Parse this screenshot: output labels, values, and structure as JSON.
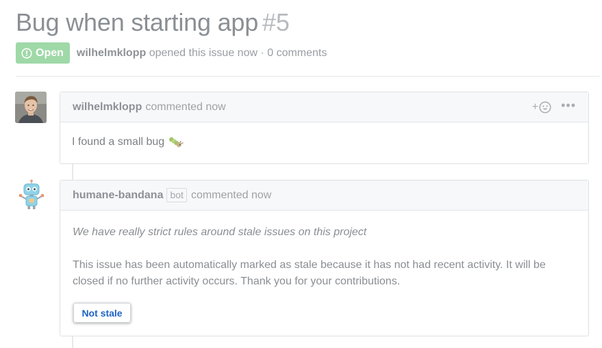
{
  "issue": {
    "title": "Bug when starting app",
    "number": "#5",
    "state": "Open",
    "author": "wilhelmklopp",
    "meta_suffix": "opened this issue now · 0 comments"
  },
  "comments": [
    {
      "author": "wilhelmklopp",
      "action": "commented now",
      "body": "I found a small bug"
    },
    {
      "author": "humane-bandana",
      "badge": "bot",
      "action": "commented now",
      "rules": "We have really strict rules around stale issues on this project",
      "message": "This issue has been automatically marked as stale because it has not had recent activity. It will be closed if no further activity occurs. Thank you for your contributions.",
      "button_label": "Not stale"
    }
  ],
  "icons": {
    "state": "issue-opened-icon",
    "reaction": "smiley-icon",
    "more": "kebab-horizontal-icon",
    "bug": "caterpillar-icon"
  },
  "colors": {
    "open_badge": "#9fd9a8",
    "link_button": "#1f61c4"
  }
}
